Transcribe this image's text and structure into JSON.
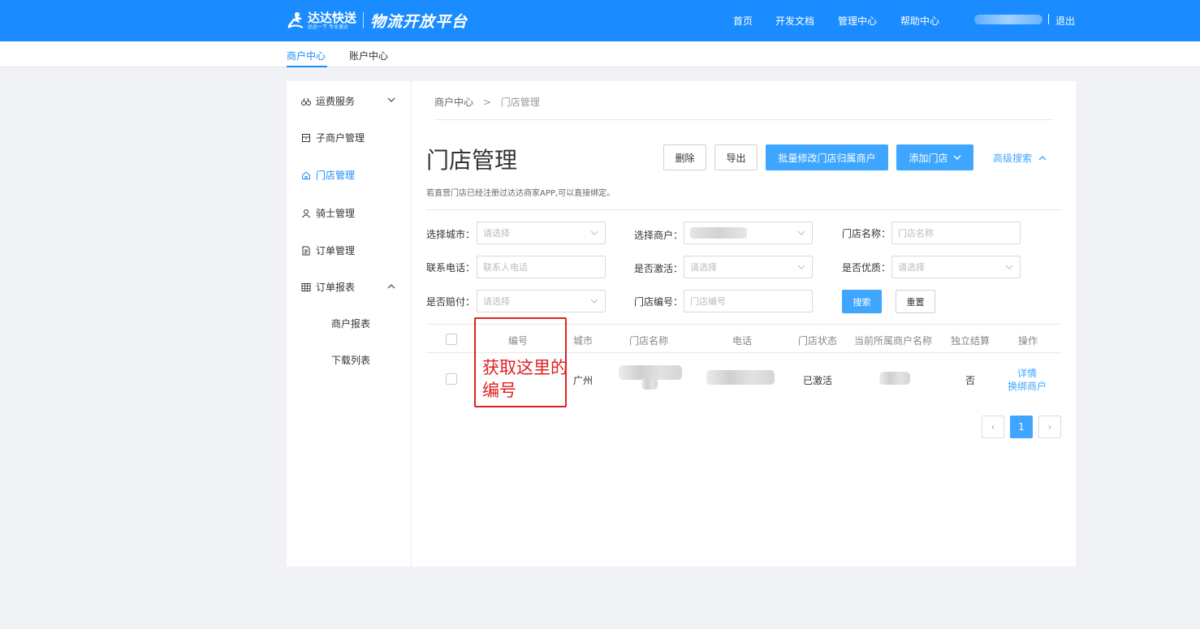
{
  "header": {
    "logo_cn": "达达快送",
    "logo_sub": "达达一下 专业速达",
    "platform": "物流开放平台",
    "nav": [
      "首页",
      "开发文档",
      "管理中心",
      "帮助中心"
    ],
    "logout": "退出"
  },
  "subnav": {
    "tabs": [
      "商户中心",
      "账户中心"
    ]
  },
  "sidebar": {
    "items": [
      {
        "label": "运费服务",
        "icon": "freight-icon"
      },
      {
        "label": "子商户管理",
        "icon": "store-icon"
      },
      {
        "label": "门店管理",
        "icon": "home-icon"
      },
      {
        "label": "骑士管理",
        "icon": "person-icon"
      },
      {
        "label": "订单管理",
        "icon": "document-icon"
      },
      {
        "label": "订单报表",
        "icon": "table-icon"
      }
    ],
    "sub_items": [
      "商户报表",
      "下载列表"
    ]
  },
  "breadcrumb": {
    "root": "商户中心",
    "sep": ">",
    "current": "门店管理"
  },
  "page": {
    "title": "门店管理",
    "tip": "若直营门店已经注册过达达商家APP,可以直接绑定。",
    "buttons": {
      "delete": "删除",
      "export": "导出",
      "batch": "批量修改门店归属商户",
      "add": "添加门店"
    },
    "advanced_search": "高级搜索"
  },
  "filters": {
    "city_label": "选择城市：",
    "city_placeholder": "请选择",
    "merchant_label": "选择商户：",
    "store_name_label": "门店名称：",
    "store_name_placeholder": "门店名称",
    "phone_label": "联系电话：",
    "phone_placeholder": "联系人电话",
    "activated_label": "是否激活：",
    "activated_placeholder": "请选择",
    "quality_label": "是否优质：",
    "quality_placeholder": "请选择",
    "compensate_label": "是否赔付：",
    "compensate_placeholder": "请选择",
    "store_no_label": "门店编号：",
    "store_no_placeholder": "门店编号",
    "search_btn": "搜索",
    "reset_btn": "重置"
  },
  "table": {
    "columns": [
      "编号",
      "城市",
      "门店名称",
      "电话",
      "门店状态",
      "当前所属商户名称",
      "独立结算",
      "操作"
    ],
    "rows": [
      {
        "city": "广州",
        "status": "已激活",
        "independent": "否",
        "actions": [
          "详情",
          "换绑商户"
        ]
      }
    ]
  },
  "annotation": {
    "text": "获取这里的编号"
  },
  "pagination": {
    "current": "1",
    "prev": "‹",
    "next": "›"
  }
}
